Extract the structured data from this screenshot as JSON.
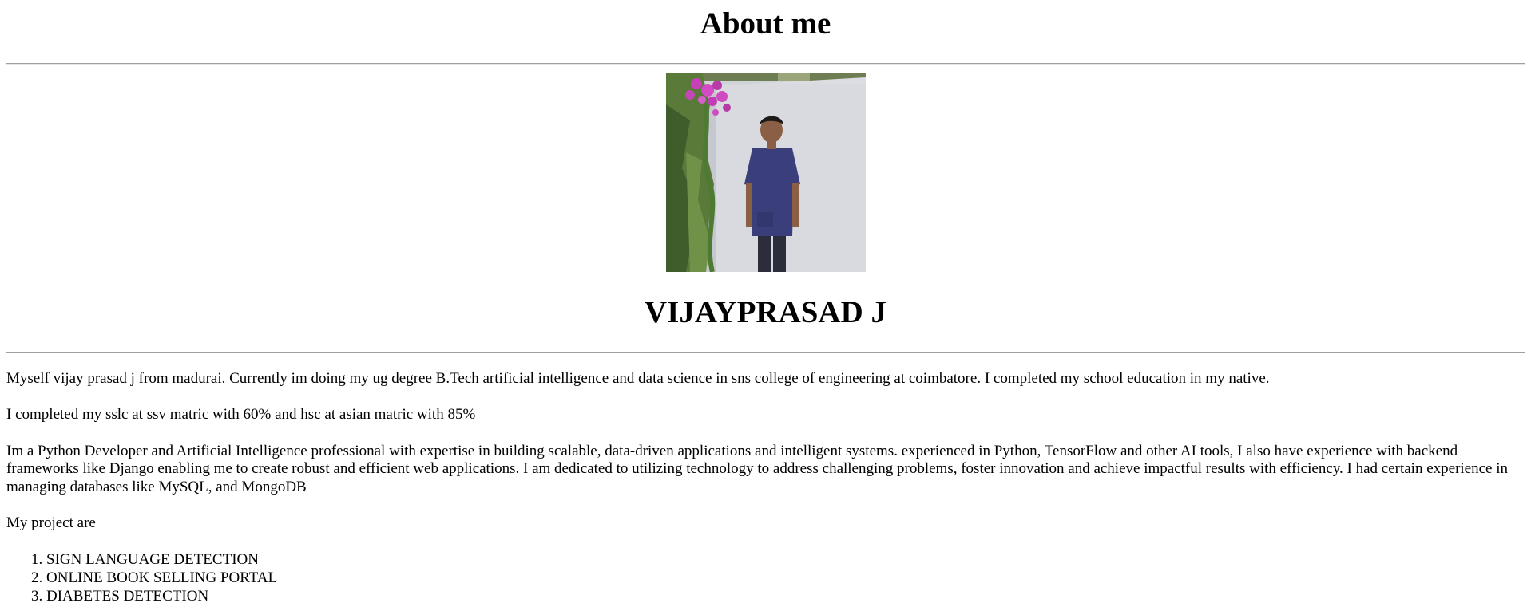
{
  "page": {
    "heading": "About me",
    "name": "VIJAYPRASAD J",
    "paragraphs": [
      "Myself vijay prasad j from madurai. Currently im doing my ug degree B.Tech artificial intelligence and data science in sns college of engineering at coimbatore. I completed my school education in my native.",
      "I completed my sslc at ssv matric with 60% and hsc at asian matric with 85%",
      "Im a Python Developer and Artificial Intelligence professional with expertise in building scalable, data-driven applications and intelligent systems. experienced in Python, TensorFlow and other AI tools, I also have experience with backend frameworks like Django enabling me to create robust and efficient web applications. I am dedicated to utilizing technology to address challenging problems, foster innovation and achieve impactful results with efficiency. I had certain experience in managing databases like MySQL, and MongoDB",
      "My project are"
    ],
    "projects": [
      "SIGN LANGUAGE DETECTION",
      "ONLINE BOOK SELLING PORTAL",
      "DIABETES DETECTION"
    ]
  },
  "colors": {
    "background": "#ffffff",
    "text": "#000000",
    "rule": "#a0a0a0"
  },
  "photo": {
    "subject": "person-standing-by-wall-with-flowers"
  }
}
